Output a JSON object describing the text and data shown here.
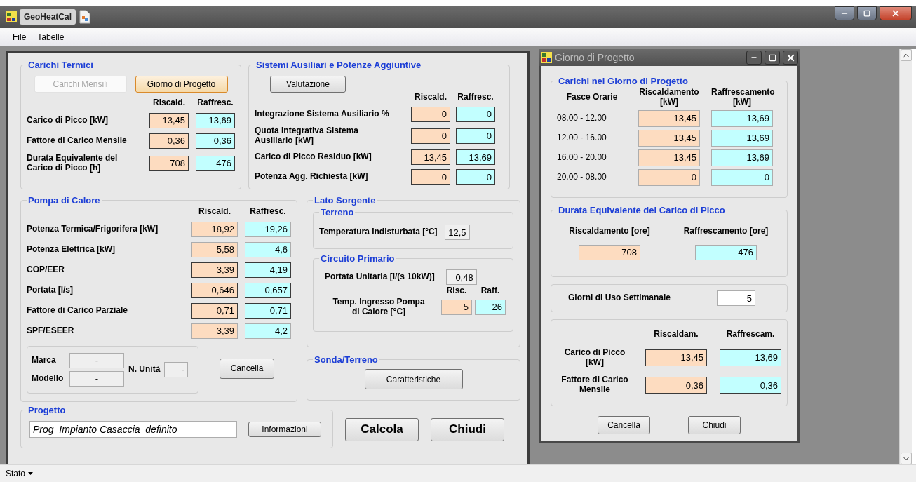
{
  "window": {
    "title": "GeoHeatCal"
  },
  "menu": [
    {
      "label": "File"
    },
    {
      "label": "Tabelle"
    }
  ],
  "main_form": {
    "carichi_termici": {
      "title": "Carichi Termici",
      "buttons": [
        {
          "label": "Carichi Mensili",
          "disabled": true,
          "focused": false
        },
        {
          "label": "Giorno di Progetto",
          "disabled": false,
          "focused": true
        }
      ],
      "columns": [
        "Riscald.",
        "Raffresc."
      ],
      "rows": [
        {
          "label": "Carico di Picco [kW]",
          "values": [
            {
              "value": "13,45",
              "kind": "heat",
              "outlined": true
            },
            {
              "value": "13,69",
              "kind": "cool",
              "outlined": true
            }
          ]
        },
        {
          "label": "Fattore di Carico Mensile",
          "values": [
            {
              "value": "0,36",
              "kind": "heat",
              "outlined": true
            },
            {
              "value": "0,36",
              "kind": "cool",
              "outlined": true
            }
          ]
        },
        {
          "label": "Durata Equivalente del\nCarico di Picco [h]",
          "values": [
            {
              "value": "708",
              "kind": "heat",
              "outlined": true
            },
            {
              "value": "476",
              "kind": "cool",
              "outlined": true
            }
          ]
        }
      ]
    },
    "sistemi_ausiliari": {
      "title": "Sistemi Ausiliari e Potenze Aggiuntive",
      "button": {
        "label": "Valutazione"
      },
      "columns": [
        "Riscald.",
        "Raffresc."
      ],
      "rows": [
        {
          "label": "Integrazione Sistema Ausiliario %",
          "values": [
            {
              "value": "0",
              "kind": "heat",
              "outlined": true
            },
            {
              "value": "0",
              "kind": "cool",
              "outlined": true
            }
          ]
        },
        {
          "label": "Quota Integrativa Sistema\nAusiliario [kW]",
          "values": [
            {
              "value": "0",
              "kind": "heat",
              "outlined": true
            },
            {
              "value": "0",
              "kind": "cool",
              "outlined": true
            }
          ]
        },
        {
          "label": "Carico di Picco Residuo [kW]",
          "values": [
            {
              "value": "13,45",
              "kind": "heat",
              "outlined": true
            },
            {
              "value": "13,69",
              "kind": "cool",
              "outlined": true
            }
          ]
        },
        {
          "label": "Potenza Agg. Richiesta [kW]",
          "values": [
            {
              "value": "0",
              "kind": "heat",
              "outlined": true
            },
            {
              "value": "0",
              "kind": "cool",
              "outlined": true
            }
          ]
        }
      ]
    },
    "pompa_di_calore": {
      "title": "Pompa di Calore",
      "columns": [
        "Riscald.",
        "Raffresc."
      ],
      "rows": [
        {
          "label": "Potenza Termica/Frigorifera [kW]",
          "values": [
            {
              "value": "18,92",
              "kind": "heat",
              "outlined": false
            },
            {
              "value": "19,26",
              "kind": "cool",
              "outlined": false
            }
          ]
        },
        {
          "label": "Potenza Elettrica [kW]",
          "values": [
            {
              "value": "5,58",
              "kind": "heat",
              "outlined": false
            },
            {
              "value": "4,6",
              "kind": "cool",
              "outlined": false
            }
          ]
        },
        {
          "label": "COP/EER",
          "values": [
            {
              "value": "3,39",
              "kind": "heat",
              "outlined": true
            },
            {
              "value": "4,19",
              "kind": "cool",
              "outlined": true
            }
          ]
        },
        {
          "label": "Portata [l/s]",
          "values": [
            {
              "value": "0,646",
              "kind": "heat",
              "outlined": true
            },
            {
              "value": "0,657",
              "kind": "cool",
              "outlined": true
            }
          ]
        },
        {
          "label": "Fattore di Carico Parziale",
          "values": [
            {
              "value": "0,71",
              "kind": "heat",
              "outlined": true
            },
            {
              "value": "0,71",
              "kind": "cool",
              "outlined": true
            }
          ]
        },
        {
          "label": "SPF/ESEER",
          "values": [
            {
              "value": "3,39",
              "kind": "heat",
              "outlined": false
            },
            {
              "value": "4,2",
              "kind": "cool",
              "outlined": false
            }
          ]
        }
      ],
      "marca": {
        "label": "Marca",
        "value": {
          "value": "-",
          "kind": "plain",
          "outlined": false
        }
      },
      "modello": {
        "label": "Modello",
        "value": {
          "value": "-",
          "kind": "plain",
          "outlined": false
        }
      },
      "n_unita": {
        "label": "N. Unità",
        "value": {
          "value": "-",
          "kind": "plain",
          "outlined": false
        }
      },
      "button": {
        "label": "Cancella"
      }
    },
    "lato_sorgente": {
      "title": "Lato Sorgente",
      "terreno": {
        "title": "Terreno",
        "label": "Temperatura Indisturbata [°C]",
        "value": {
          "value": "12,5",
          "kind": "plain",
          "outlined": false
        }
      },
      "circuito_primario": {
        "title": "Circuito Primario",
        "portata": {
          "label": "Portata Unitaria [l/(s 10kW)]",
          "value": {
            "value": "0,48",
            "kind": "plain",
            "outlined": false
          }
        },
        "columns": [
          "Risc.",
          "Raff."
        ],
        "temp": {
          "label": "Temp. Ingresso Pompa\ndi Calore [°C]",
          "values": [
            {
              "value": "5",
              "kind": "heat",
              "outlined": false
            },
            {
              "value": "26",
              "kind": "cool",
              "outlined": false
            }
          ]
        }
      }
    },
    "sonda_terreno": {
      "title": "Sonda/Terreno",
      "button": {
        "label": "Caratteristiche"
      }
    },
    "progetto": {
      "title": "Progetto",
      "value": "Prog_Impianto Casaccia_definito",
      "button": {
        "label": "Informazioni"
      }
    },
    "actions": [
      {
        "label": "Calcola"
      },
      {
        "label": "Chiudi"
      }
    ]
  },
  "design_day_window": {
    "title": "Giorno di Progetto",
    "loads": {
      "title": "Carichi nel Giorno di Progetto",
      "row_header": "Fasce Orarie",
      "columns": [
        "Riscaldamento\n[kW]",
        "Raffrescamento\n[kW]"
      ],
      "rows": [
        {
          "label": "08.00 - 12.00",
          "values": [
            {
              "value": "13,45",
              "kind": "heat",
              "outlined": false
            },
            {
              "value": "13,69",
              "kind": "cool",
              "outlined": false
            }
          ]
        },
        {
          "label": "12.00 - 16.00",
          "values": [
            {
              "value": "13,45",
              "kind": "heat",
              "outlined": false
            },
            {
              "value": "13,69",
              "kind": "cool",
              "outlined": false
            }
          ]
        },
        {
          "label": "16.00 - 20.00",
          "values": [
            {
              "value": "13,45",
              "kind": "heat",
              "outlined": false
            },
            {
              "value": "13,69",
              "kind": "cool",
              "outlined": false
            }
          ]
        },
        {
          "label": "20.00 - 08.00",
          "values": [
            {
              "value": "0",
              "kind": "heat",
              "outlined": false
            },
            {
              "value": "0",
              "kind": "cool",
              "outlined": false
            }
          ]
        }
      ]
    },
    "durata": {
      "title": "Durata Equivalente del Carico di Picco",
      "columns": [
        "Riscaldamento [ore]",
        "Raffrescamento [ore]"
      ],
      "values": [
        {
          "value": "708",
          "kind": "heat",
          "outlined": false
        },
        {
          "value": "476",
          "kind": "cool",
          "outlined": false
        }
      ]
    },
    "giorni": {
      "label": "Giorni di Uso Settimanale",
      "value": {
        "value": "5",
        "kind": "white",
        "outlined": false
      }
    },
    "picco": {
      "columns": [
        "Riscaldam.",
        "Raffrescam."
      ],
      "rows": [
        {
          "label": "Carico di Picco\n[kW]",
          "values": [
            {
              "value": "13,45",
              "kind": "heat",
              "outlined": true
            },
            {
              "value": "13,69",
              "kind": "cool",
              "outlined": true
            }
          ]
        },
        {
          "label": "Fattore di Carico\nMensile",
          "values": [
            {
              "value": "0,36",
              "kind": "heat",
              "outlined": true
            },
            {
              "value": "0,36",
              "kind": "cool",
              "outlined": true
            }
          ]
        }
      ]
    },
    "buttons": [
      {
        "label": "Cancella"
      },
      {
        "label": "Chiudi"
      }
    ]
  },
  "status_bar": {
    "label": "Stato"
  }
}
